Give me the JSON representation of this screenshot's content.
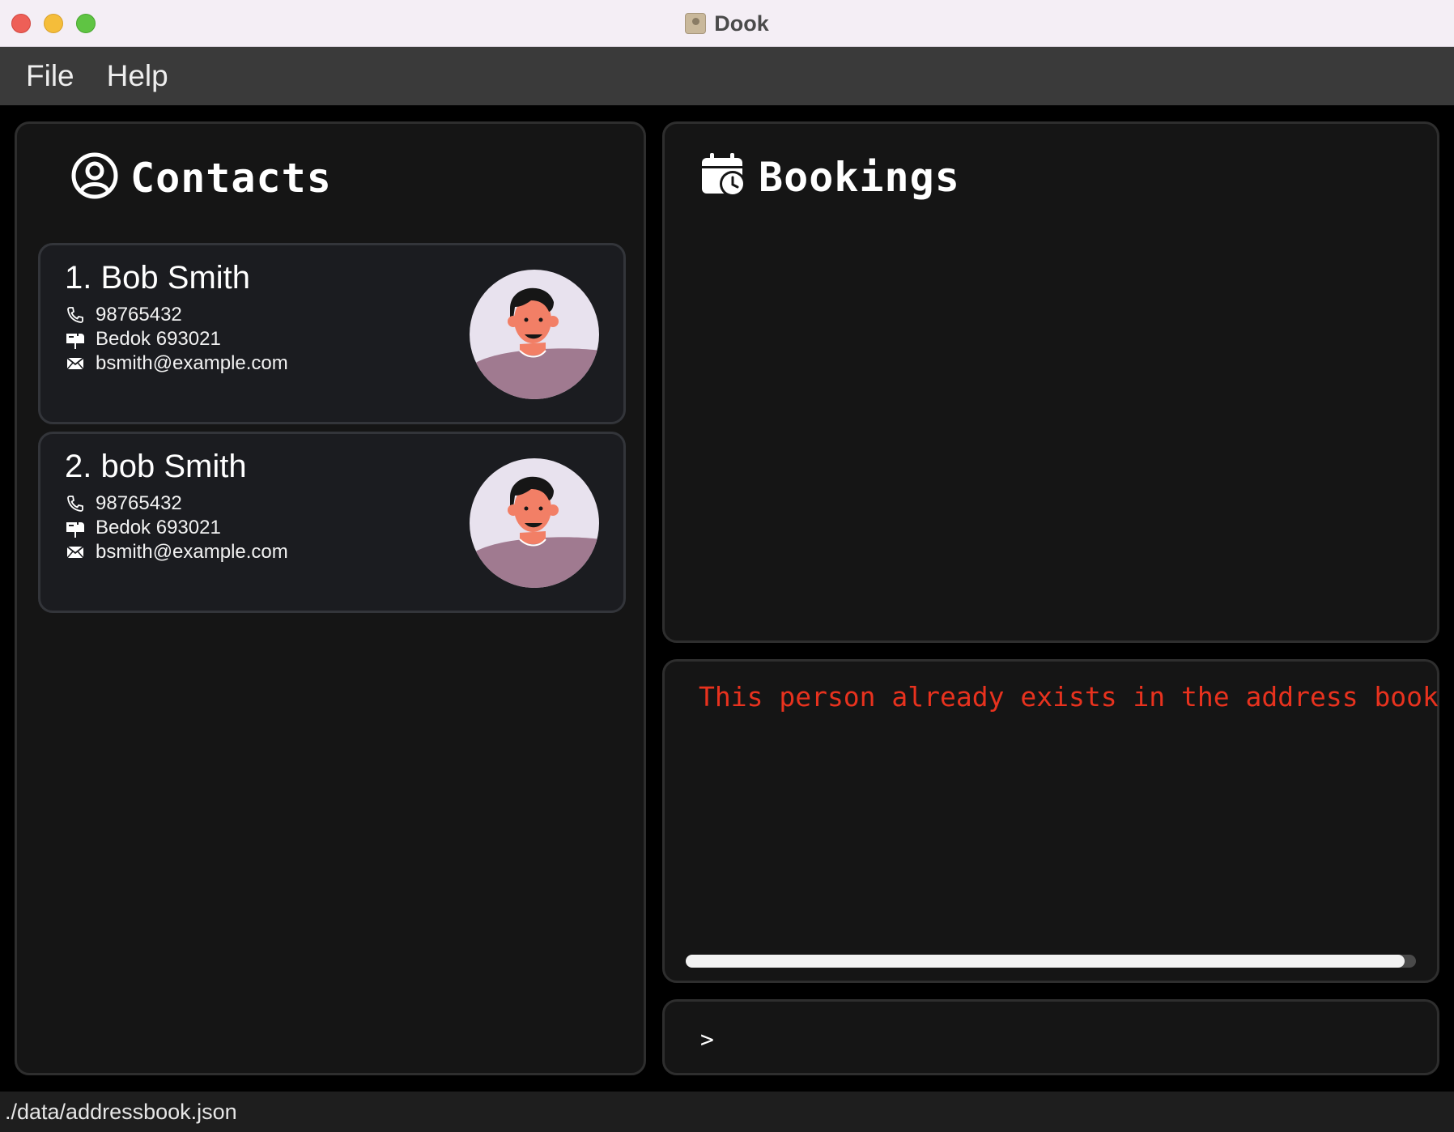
{
  "window": {
    "title": "Dook"
  },
  "menu": {
    "items": [
      "File",
      "Help"
    ]
  },
  "contacts": {
    "title": "Contacts",
    "list": [
      {
        "name": "1. Bob Smith",
        "phone": "98765432",
        "address": "Bedok 693021",
        "email": "bsmith@example.com"
      },
      {
        "name": "2. bob Smith",
        "phone": "98765432",
        "address": "Bedok 693021",
        "email": "bsmith@example.com"
      }
    ]
  },
  "bookings": {
    "title": "Bookings"
  },
  "result": {
    "message": "This person already exists in the address book",
    "scroll_fraction": 0.985
  },
  "command": {
    "prompt": ">",
    "value": ""
  },
  "status": {
    "file_path": "./data/addressbook.json"
  },
  "colors": {
    "error": "#e8321e",
    "panel": "#151515",
    "card": "#1b1c20"
  }
}
